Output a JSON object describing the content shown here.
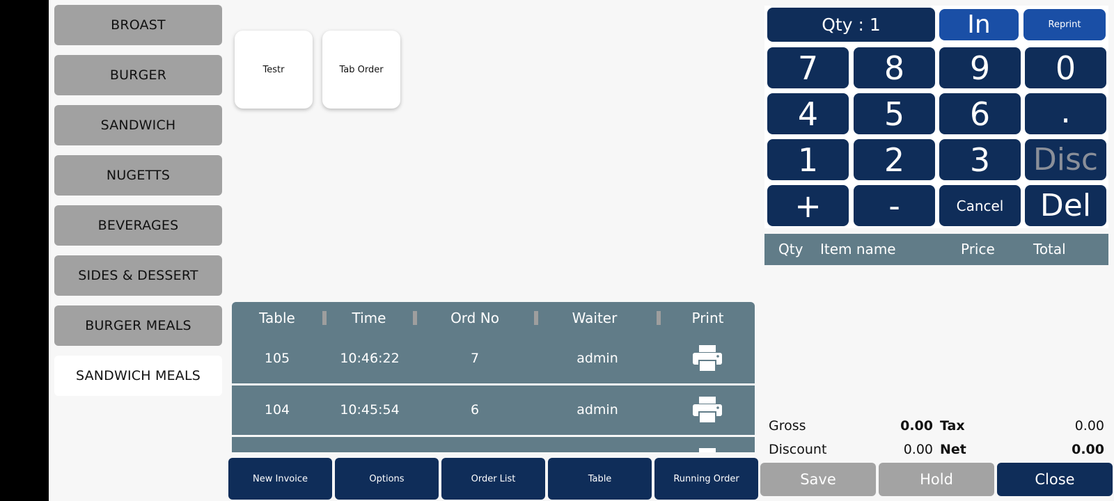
{
  "categories": [
    "BROAST",
    "BURGER",
    "SANDWICH",
    "NUGETTS",
    "BEVERAGES",
    "SIDES & DESSERT",
    "BURGER MEALS",
    "SANDWICH MEALS"
  ],
  "items": [
    "Testr",
    "Tab Order"
  ],
  "orders": {
    "headers": [
      "Table",
      "Time",
      "Ord No",
      "Waiter",
      "Print"
    ],
    "rows": [
      {
        "table": "105",
        "time": "10:46:22",
        "ord_no": "7",
        "waiter": "admin"
      },
      {
        "table": "104",
        "time": "10:45:54",
        "ord_no": "6",
        "waiter": "admin"
      }
    ]
  },
  "bottom_buttons": [
    "New Invoice",
    "Options",
    "Order List",
    "Table",
    "Running Order"
  ],
  "keypad": {
    "qty_label": "Qty : 1",
    "in_label": "In",
    "reprint_label": "Reprint",
    "keys": [
      "7",
      "8",
      "9",
      "0",
      "4",
      "5",
      "6",
      ".",
      "1",
      "2",
      "3",
      "Disc",
      "+",
      "-",
      "Cancel",
      "Del"
    ]
  },
  "item_list": {
    "headers": [
      "Qty",
      "Item name",
      "Price",
      "Total"
    ]
  },
  "totals": {
    "gross_label": "Gross",
    "gross": "0.00",
    "tax_label": "Tax",
    "tax": "0.00",
    "discount_label": "Discount",
    "discount": "0.00",
    "net_label": "Net",
    "net": "0.00"
  },
  "actions": {
    "save": "Save",
    "hold": "Hold",
    "close": "Close"
  },
  "colors": {
    "navy": "#0f2d59",
    "blue": "#1a4fa6",
    "slate": "#617c88",
    "gray": "#a1a1a1"
  }
}
